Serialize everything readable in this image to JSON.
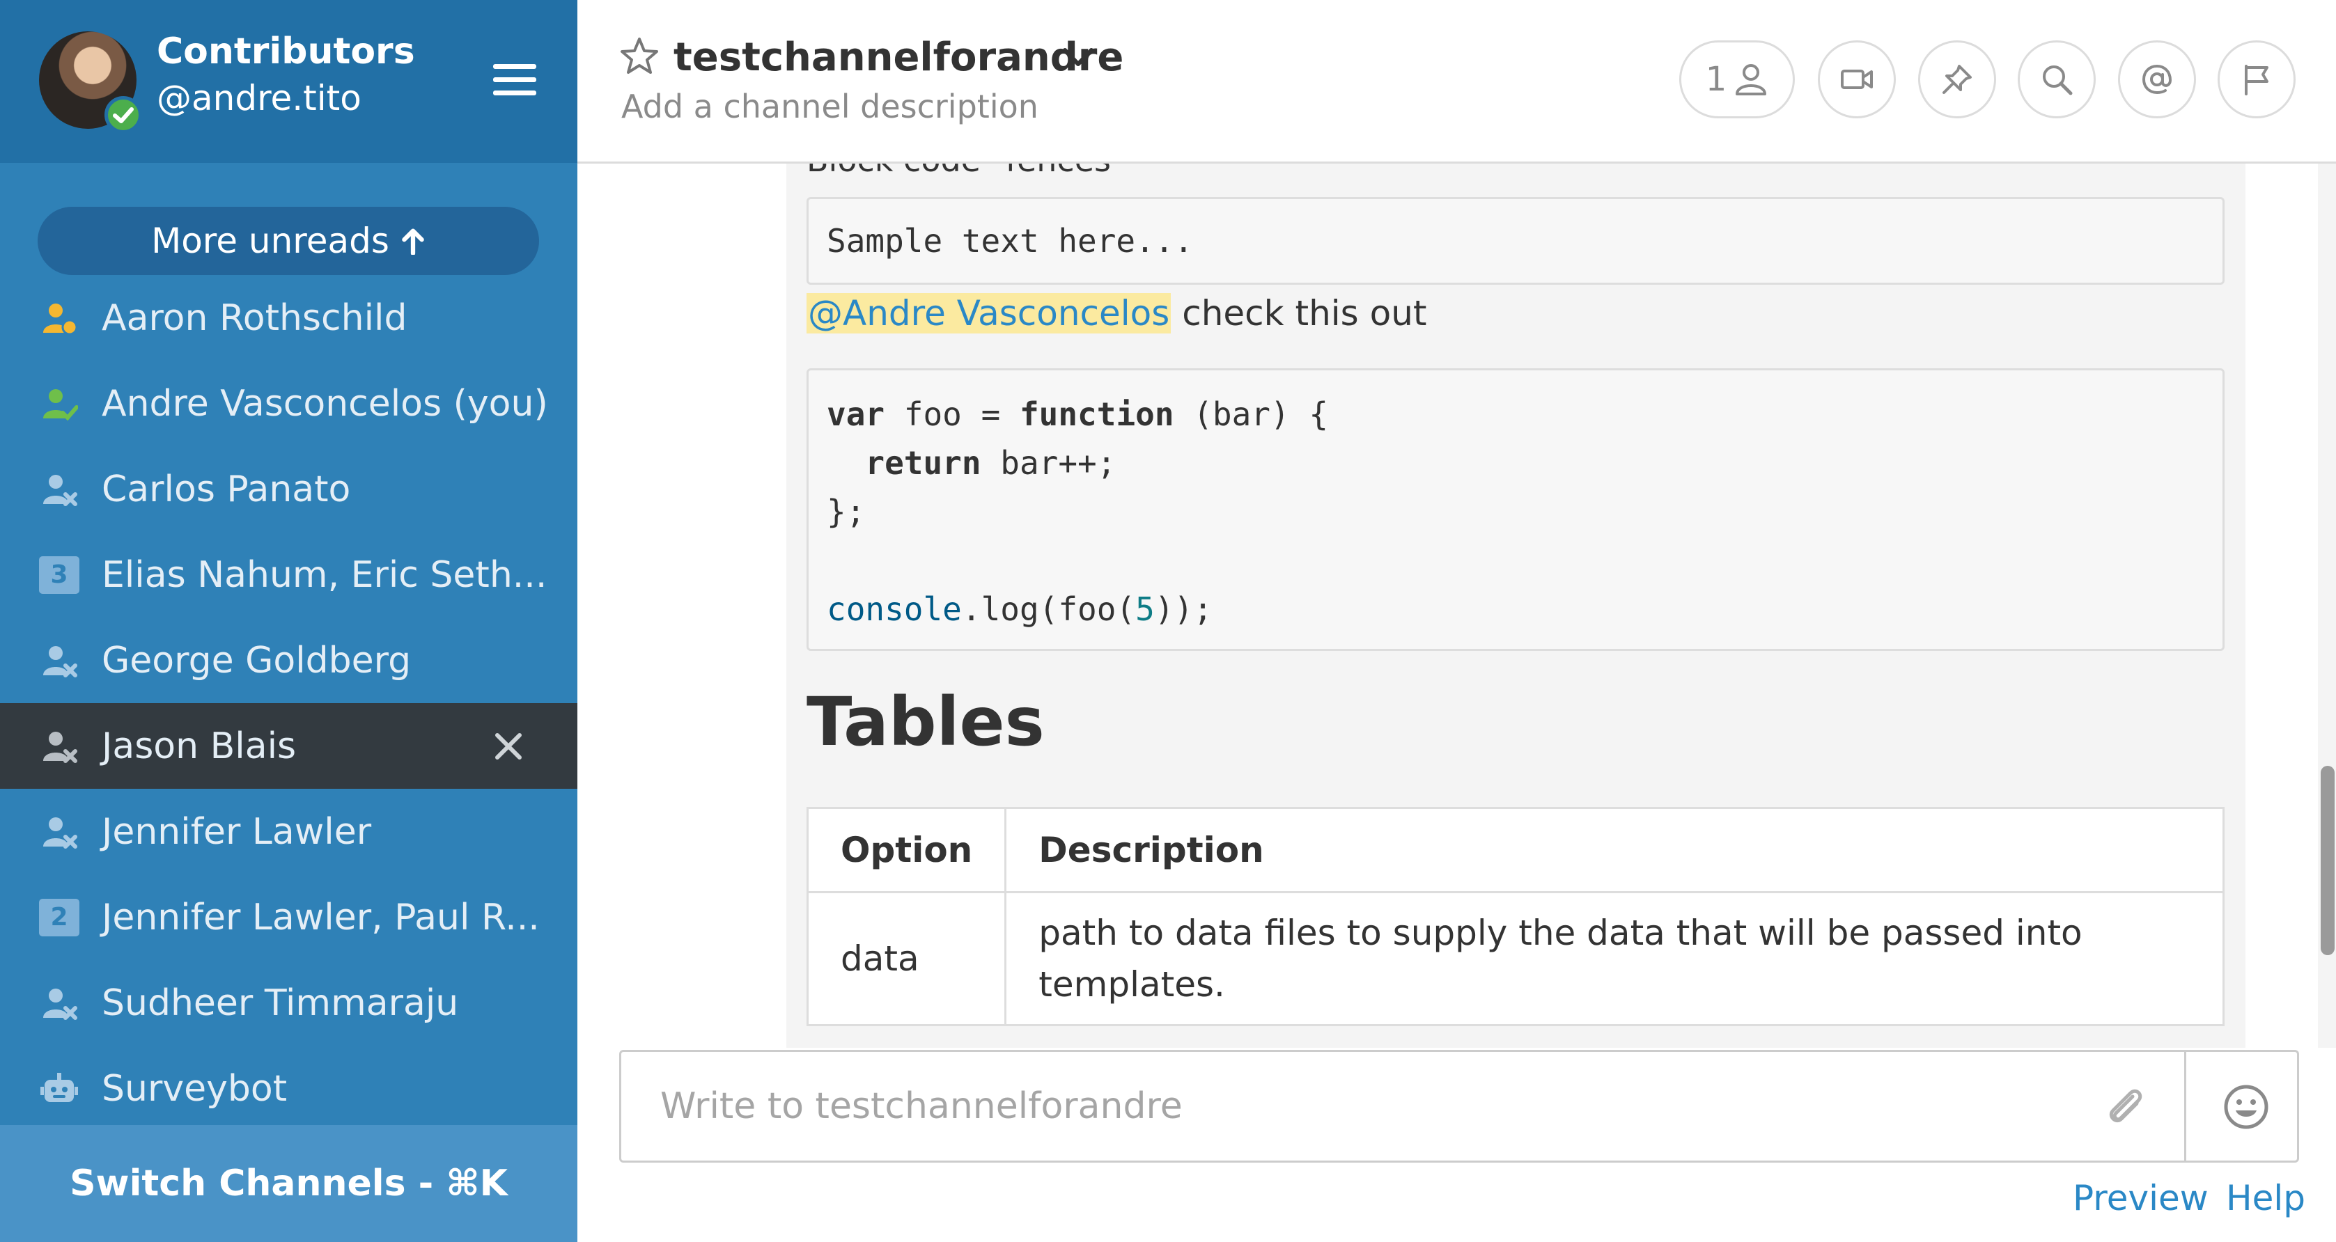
{
  "sidebar": {
    "team_name": "Contributors",
    "user_handle": "@andre.tito",
    "more_unreads": "More unreads",
    "channels": [
      {
        "label": "Aaron Rothschild",
        "icon": "away-user-icon"
      },
      {
        "label": "Andre Vasconcelos (you)",
        "icon": "online-user-icon"
      },
      {
        "label": "Carlos Panato",
        "icon": "offline-user-icon"
      },
      {
        "label": "Elias Nahum, Eric Seth...",
        "badge": "3"
      },
      {
        "label": "George Goldberg",
        "icon": "offline-user-icon"
      },
      {
        "label": "Jason Blais",
        "icon": "offline-user-icon",
        "active": true
      },
      {
        "label": "Jennifer Lawler",
        "icon": "offline-user-icon"
      },
      {
        "label": "Jennifer Lawler, Paul R...",
        "badge": "2"
      },
      {
        "label": "Sudheer Timmaraju",
        "icon": "offline-user-icon"
      },
      {
        "label": "Surveybot",
        "icon": "bot-icon"
      }
    ],
    "switch_channels": "Switch Channels - ⌘K"
  },
  "header": {
    "channel_name": "testchannelforandre",
    "channel_description": "Add a channel description",
    "member_count": "1"
  },
  "post": {
    "cut_heading": "Block code \"fences\"",
    "code1": "Sample text here...",
    "mention": "@Andre Vasconcelos",
    "mention_rest": " check this out",
    "code2": {
      "l1": {
        "a": "var",
        "b": " foo = ",
        "c": "function",
        "d": " (bar) {"
      },
      "l2": {
        "a": "  ",
        "b": "return",
        "c": " bar++;"
      },
      "l3": "};",
      "l5": {
        "a": "console",
        "b": ".log(foo(",
        "c": "5",
        "d": "));"
      }
    },
    "tables_heading": "Tables",
    "table": {
      "headers": [
        "Option",
        "Description"
      ],
      "rows": [
        [
          "data",
          "path to data files to supply the data that will be passed into templates."
        ]
      ]
    }
  },
  "composer": {
    "placeholder": "Write to testchannelforandre",
    "preview": "Preview",
    "help": "Help"
  },
  "colors": {
    "sidebar_bg": "#2f81b7",
    "sidebar_header_bg": "#2270a6",
    "active_channel_bg": "#333a40",
    "link": "#2a88c6",
    "mention_highlight": "#fbeaa0",
    "online": "#4cae4c",
    "away": "#f5b731"
  }
}
